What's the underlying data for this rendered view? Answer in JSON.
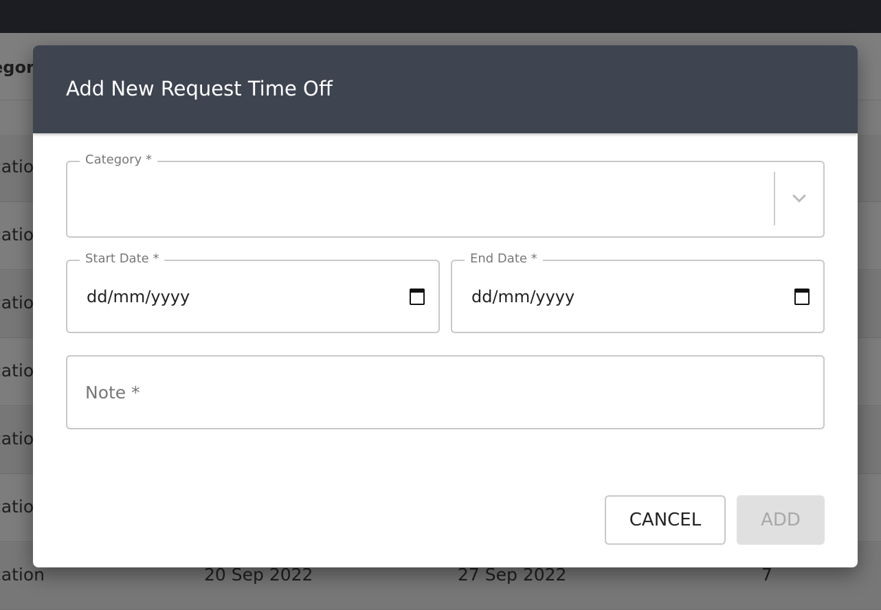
{
  "background": {
    "header_partial": "egor",
    "rows": [
      {
        "category": "cation"
      },
      {
        "category": "cation"
      },
      {
        "category": "cation"
      },
      {
        "category": "cation"
      },
      {
        "category": "cation"
      },
      {
        "category": "cation"
      },
      {
        "category": "cation",
        "start": "20 Sep 2022",
        "end": "27 Sep 2022",
        "days": "7"
      }
    ]
  },
  "dialog": {
    "title": "Add New Request Time Off",
    "category": {
      "label": "Category *",
      "value": ""
    },
    "start_date": {
      "label": "Start Date *",
      "value": "dd/mm/yyyy"
    },
    "end_date": {
      "label": "End Date *",
      "value": "dd/mm/yyyy"
    },
    "note": {
      "placeholder": "Note *"
    },
    "cancel_label": "CANCEL",
    "add_label": "ADD"
  }
}
